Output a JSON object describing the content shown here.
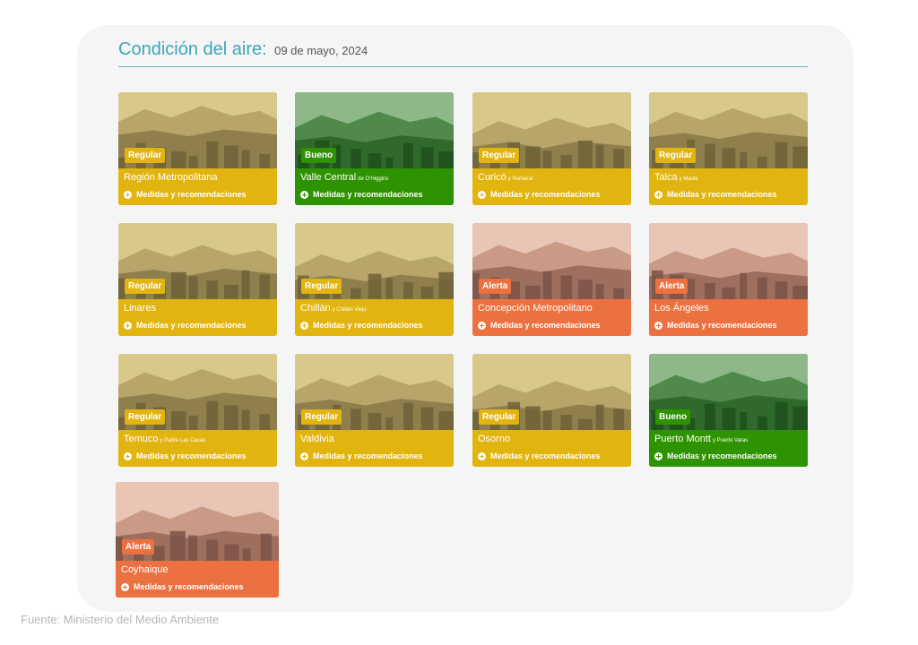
{
  "header": {
    "title": "Condición del aire:",
    "date": "09 de mayo, 2024"
  },
  "footer": {
    "source": "Fuente: Ministerio del Medio Ambiente"
  },
  "link_label": "Medidas y recomendaciones",
  "status_colors": {
    "Regular": "#e2b410",
    "Bueno": "#2e9300",
    "Alerta": "#ec7140"
  },
  "cards": [
    {
      "city": "Región Metropolitana",
      "sub": "",
      "status": "Regular"
    },
    {
      "city": "Valle Central",
      "sub": "de O'Higgins",
      "status": "Bueno"
    },
    {
      "city": "Curicó",
      "sub": "y Romeral",
      "status": "Regular"
    },
    {
      "city": "Talca",
      "sub": "y Maule",
      "status": "Regular"
    },
    {
      "city": "Linares",
      "sub": "",
      "status": "Regular"
    },
    {
      "city": "Chillán",
      "sub": "y Chillán Viejo",
      "status": "Regular"
    },
    {
      "city": "Concepción Metropolitano",
      "sub": "",
      "status": "Alerta"
    },
    {
      "city": "Los Ángeles",
      "sub": "",
      "status": "Alerta"
    },
    {
      "city": "Temuco",
      "sub": "y Padre Las Casas",
      "status": "Regular"
    },
    {
      "city": "Valdivia",
      "sub": "",
      "status": "Regular"
    },
    {
      "city": "Osorno",
      "sub": "",
      "status": "Regular"
    },
    {
      "city": "Puerto Montt",
      "sub": "y Puerto Varas",
      "status": "Bueno"
    },
    {
      "city": "Coyhaique",
      "sub": "",
      "status": "Alerta"
    }
  ]
}
